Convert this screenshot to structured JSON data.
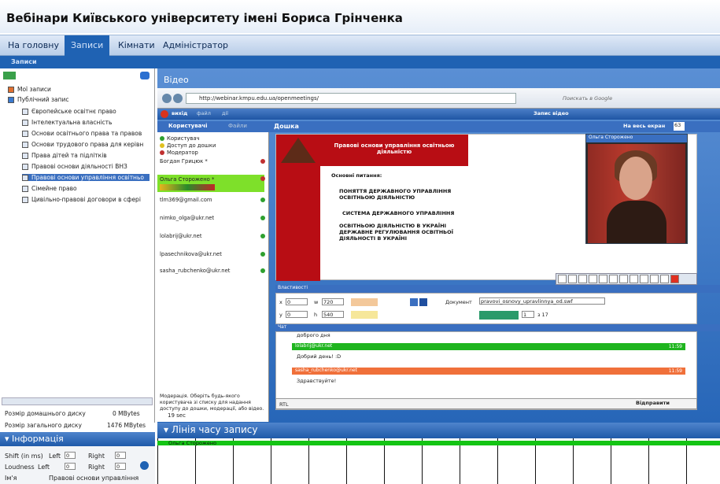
{
  "page": {
    "title": "Вебінари Київського університету імені Бориса Грінченка"
  },
  "nav": {
    "home": "На головну",
    "records": "Записи",
    "rooms": "Кімнати",
    "admin": "Адміністратор",
    "sub": "Записи"
  },
  "tree": {
    "my": "Мої записи",
    "public": "Публічний запис",
    "items": [
      "Європейське освітнє право",
      "Інтелектуальна власність",
      "Основи освітнього права та правов",
      "Основи трудового права для керівн",
      "Права дітей та підлітків",
      "Правові основи діяльності ВНЗ",
      "Правові основи управління освітньо",
      "Сімейне право",
      "Цивільно-правові договори в сфері"
    ]
  },
  "disk": {
    "home_label": "Розмір домашнього диску",
    "home_val": "0 MBytes",
    "total_label": "Розмір загального диску",
    "total_val": "1476 MBytes"
  },
  "info": {
    "title": "Інформація",
    "shift": "Shift (in ms)",
    "left": "Left",
    "right": "Right",
    "loudness": "Loudness",
    "lv": "0",
    "rv": "0",
    "name_label": "Ім'я",
    "name_val": "Правові основи управління"
  },
  "video": {
    "title": "Відео",
    "url": "http://webinar.kmpu.edu.ua/openmeetings/",
    "exit": "вихід",
    "file": "файл",
    "actions": "дії",
    "record": "Запис відео",
    "search": "Поискать в Google"
  },
  "users": {
    "tab": "Користувачі",
    "files": "Файли",
    "legend": [
      "Користувач",
      "Доступ до дошки",
      "Модератор"
    ],
    "list": [
      "Богдан Грицюк *",
      "Ольга Сторожено *",
      "tlm369@gmail.com",
      "nimko_olga@ukr.net",
      "lolabrij@ukr.net",
      "lpasechnikova@ukr.net",
      "sasha_rubchenko@ukr.net"
    ],
    "hint": "Модерація. Оберіть будь-якого користувача зі списку для надання доступу до дошки, модерації, або відео."
  },
  "board": {
    "title": "Дошка",
    "fullscreen": "На весь екран",
    "zoom": "63",
    "slide_head": "Правові основи управління освітньою діяльністю",
    "main": "Основні питання:",
    "p1": "ПОНЯТТЯ ДЕРЖАВНОГО УПРАВЛІННЯ ОСВІТНЬОЮ ДІЯЛЬНІСТЮ",
    "p2": "СИСТЕМА ДЕРЖАВНОГО УПРАВЛІННЯ",
    "p3": "ОСВІТНЬОЮ ДІЯЛЬНІСТЮ В УКРАЇНІ ДЕРЖАВНЕ РЕГУЛЮВАННЯ ОСВІТНЬОЇ ДІЯЛЬНОСТІ В УКРАЇНІ"
  },
  "cam": {
    "name": "Ольга Сторожено"
  },
  "props": {
    "title": "Властивості",
    "x": "0",
    "w": "720",
    "y": "0",
    "h": "540",
    "doc_label": "Документ",
    "doc": "pravovi_osnovy_upravlinnya_od.swf",
    "page": "1",
    "pages": "з 17"
  },
  "chat": {
    "title": "Чат",
    "m0": "доброго дня",
    "u1": "lolabrij@ukr.net",
    "m1": "Добрий день! :D",
    "t1": "11:59",
    "u2": "sasha_rubchenko@ukr.net",
    "m2": "Здравствуйте!",
    "t2": "11:59",
    "rtl": "RTL",
    "send": "Відправити"
  },
  "status": {
    "time": "19 sec"
  },
  "timeline": {
    "title": "Лінія часу запису",
    "user": "Ольга Сторожено"
  }
}
